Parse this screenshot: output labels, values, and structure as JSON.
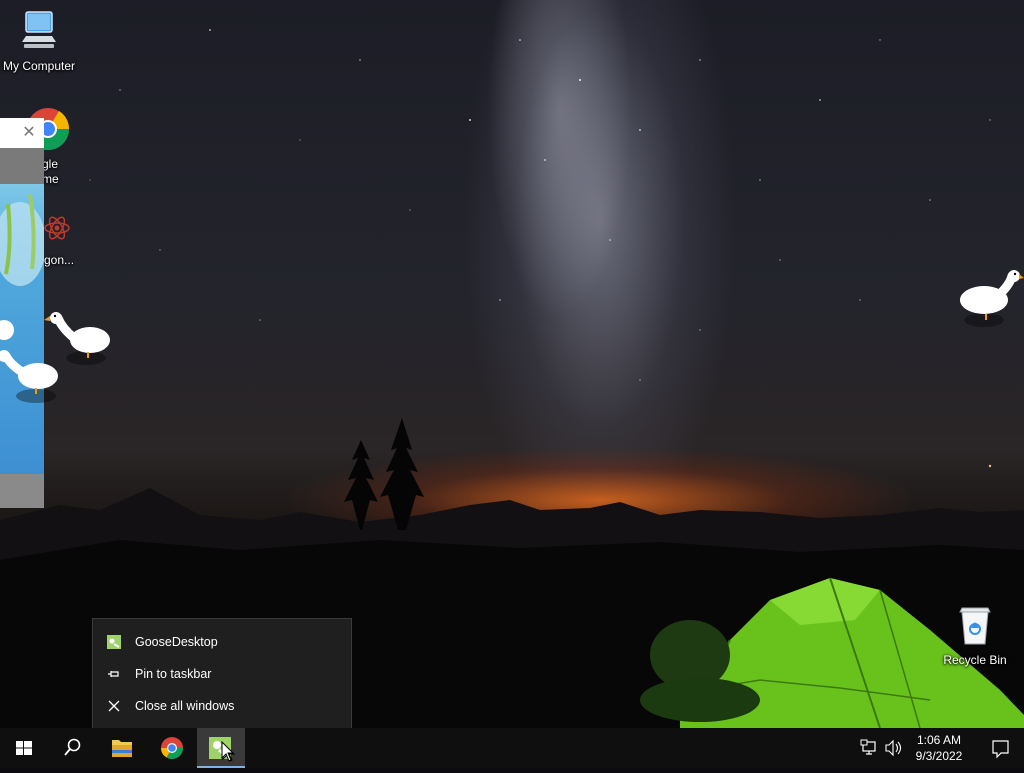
{
  "desktop": {
    "icons": [
      {
        "label": "My Computer"
      },
      {
        "label": "gle\nme"
      },
      {
        "label": "gon..."
      },
      {
        "label": "Recycle Bin"
      }
    ]
  },
  "partial_window": {
    "close_glyph": "✕"
  },
  "jumplist": {
    "items": [
      {
        "label": "GooseDesktop",
        "icon": "goose-app-icon"
      },
      {
        "label": "Pin to taskbar",
        "icon": "pin-icon"
      },
      {
        "label": "Close all windows",
        "icon": "close-icon"
      }
    ]
  },
  "taskbar": {
    "buttons": [
      {
        "name": "start",
        "icon": "windows-logo-icon"
      },
      {
        "name": "search",
        "icon": "search-icon"
      },
      {
        "name": "file-explorer",
        "icon": "folder-icon"
      },
      {
        "name": "chrome",
        "icon": "chrome-icon"
      },
      {
        "name": "goose-desktop",
        "icon": "goose-app-icon",
        "active": true
      }
    ],
    "clock": {
      "time": "1:06 AM",
      "date": "9/3/2022"
    }
  },
  "colors": {
    "accent": "#7fb2e6",
    "taskbar": "#0f0f0f",
    "jumplist": "#1f1f1f"
  }
}
